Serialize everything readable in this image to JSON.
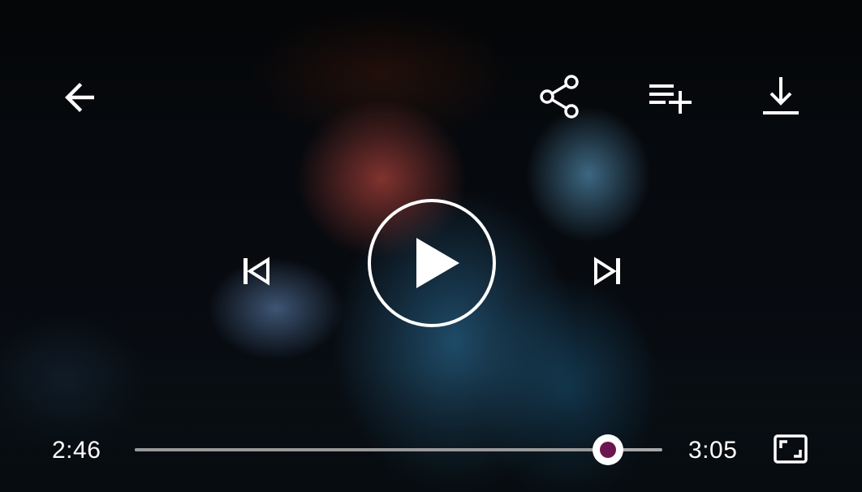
{
  "player": {
    "playback": {
      "current_time": "2:46",
      "duration": "3:05",
      "progress_fraction": 0.8975
    },
    "icons": {
      "back": "arrow-back-icon",
      "share": "share-icon",
      "add_to_queue": "playlist-add-icon",
      "download": "download-icon",
      "previous": "skip-previous-icon",
      "play": "play-circle-icon",
      "next": "skip-next-icon",
      "fullscreen": "fullscreen-icon"
    },
    "colors": {
      "icon": "#ffffff",
      "seek_thumb_accent": "#6b1550",
      "seek_track": "#d8d8d8"
    }
  }
}
